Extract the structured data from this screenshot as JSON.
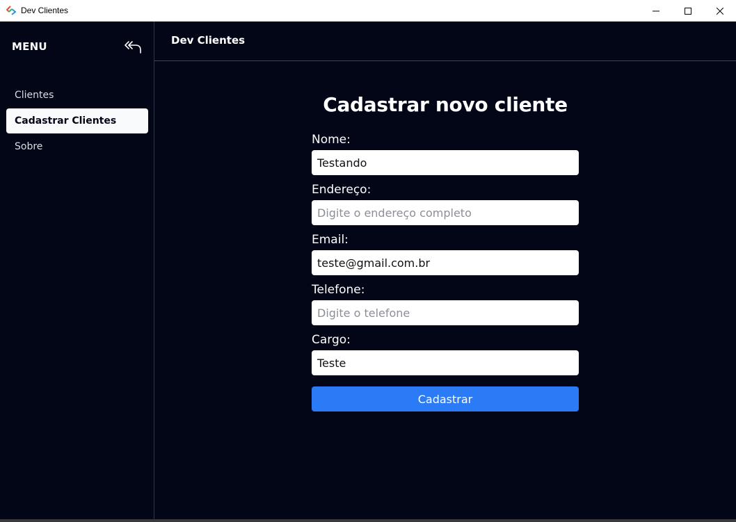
{
  "window": {
    "title": "Dev Clientes"
  },
  "sidebar": {
    "menu_label": "MENU",
    "items": [
      {
        "label": "Clientes",
        "active": false
      },
      {
        "label": "Cadastrar Clientes",
        "active": true
      },
      {
        "label": "Sobre",
        "active": false
      }
    ]
  },
  "header": {
    "title": "Dev Clientes"
  },
  "form": {
    "title": "Cadastrar novo cliente",
    "fields": [
      {
        "label": "Nome:",
        "value": "Testando",
        "placeholder": ""
      },
      {
        "label": "Endereço:",
        "value": "",
        "placeholder": "Digite o endereço completo"
      },
      {
        "label": "Email:",
        "value": "teste@gmail.com.br",
        "placeholder": ""
      },
      {
        "label": "Telefone:",
        "value": "",
        "placeholder": "Digite o telefone"
      },
      {
        "label": "Cargo:",
        "value": "Teste",
        "placeholder": ""
      }
    ],
    "submit_label": "Cadastrar"
  },
  "colors": {
    "background": "#020617",
    "accent": "#2a7bf5",
    "active_item_bg": "#f8fafc"
  }
}
